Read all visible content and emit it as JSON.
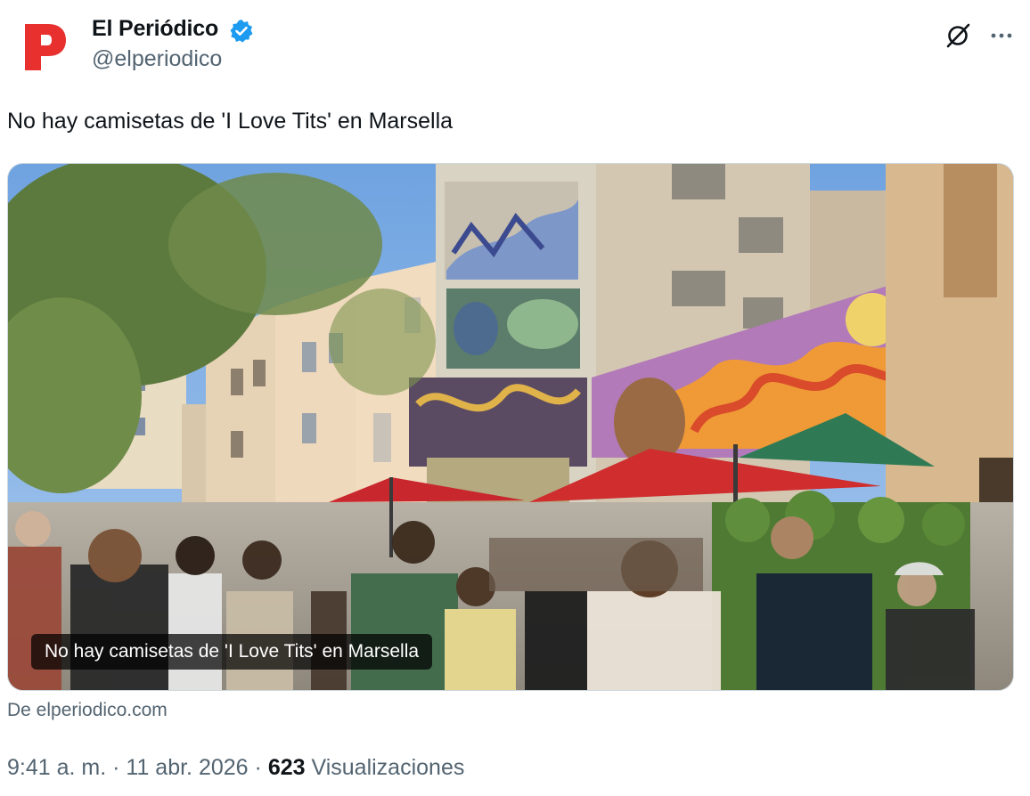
{
  "account": {
    "display_name": "El Periódico",
    "handle": "@elperiodico",
    "avatar_letter": "P",
    "avatar_color": "#e8312f",
    "verified": true,
    "verified_color": "#1d9bf0"
  },
  "tweet": {
    "text": "No hay camisetas de 'I Love Tits' en Marsella"
  },
  "media": {
    "caption": "No hay camisetas de 'I Love Tits' en Marsella",
    "source": "De elperiodico.com"
  },
  "meta": {
    "time": "9:41 a. m.",
    "separator": "·",
    "date": "11 abr. 2026",
    "views_count": "623",
    "views_label": "Visualizaciones"
  },
  "icons": {
    "verified": "verified-badge-icon",
    "grok": "grok-icon",
    "more": "more-options-icon"
  },
  "colors": {
    "text_primary": "#0f1419",
    "text_secondary": "#536471",
    "border": "#cfd9de"
  }
}
